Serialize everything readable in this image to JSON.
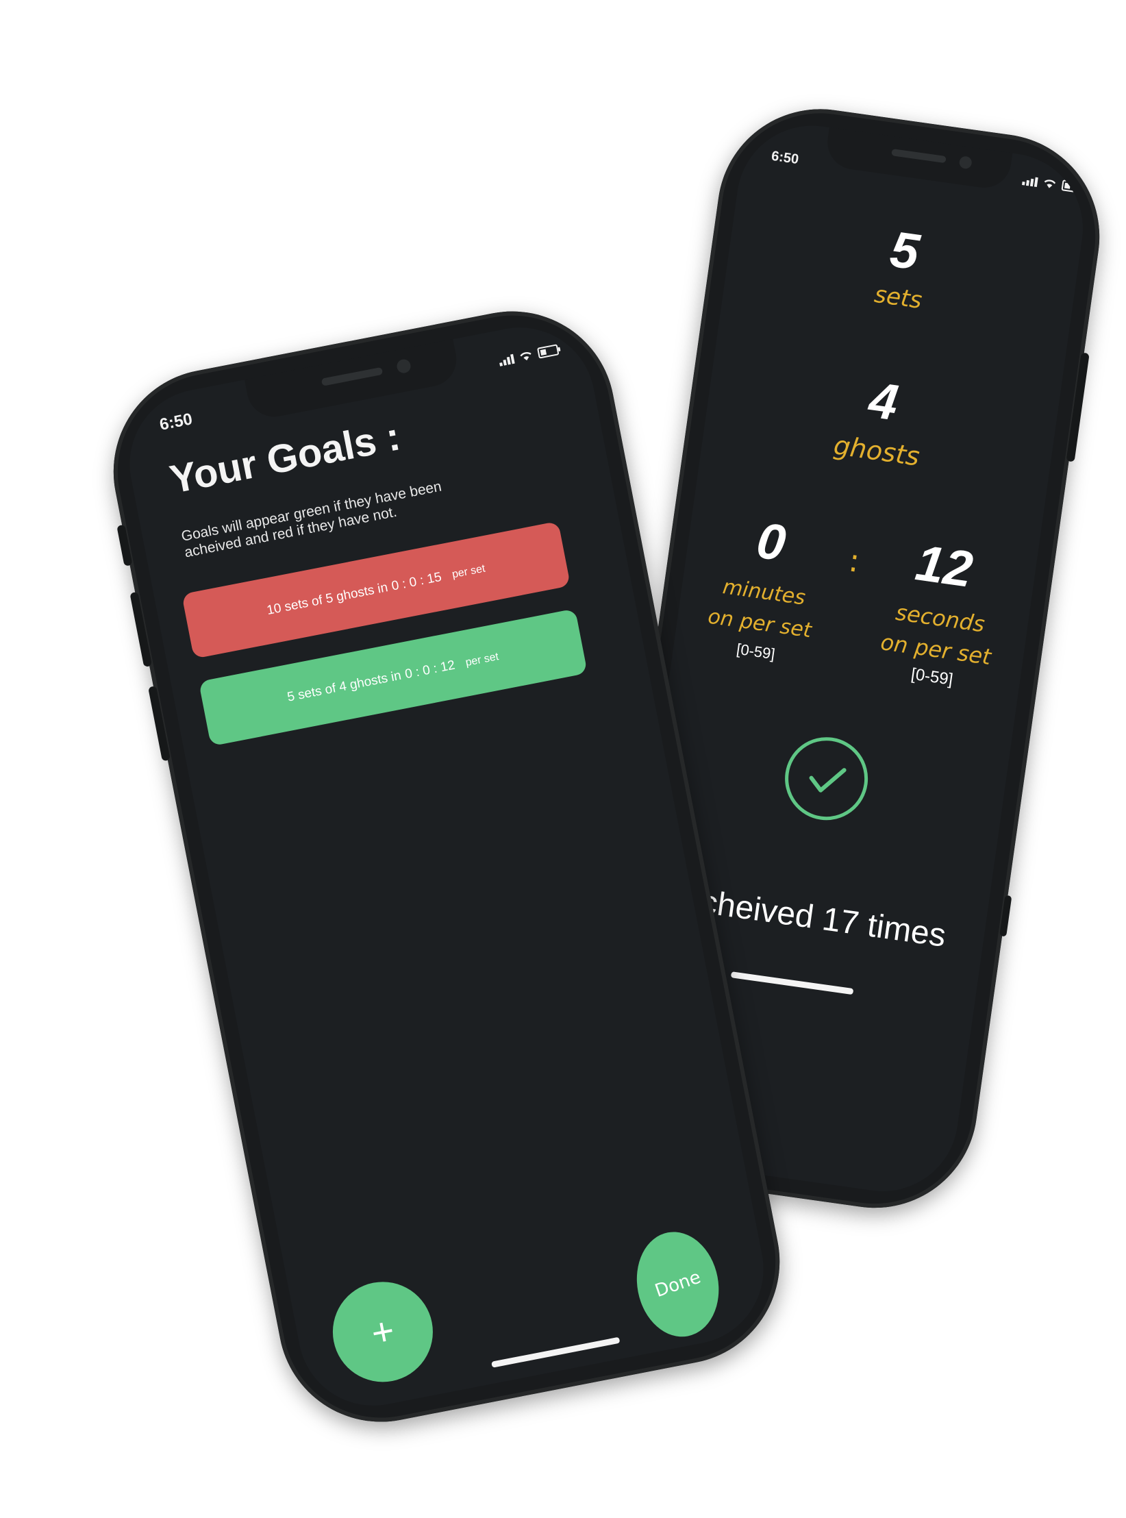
{
  "left_phone": {
    "status": {
      "time": "6:50"
    },
    "title": "Your Goals :",
    "description": "Goals will appear green if they have been acheived and red if they have not.",
    "goals": [
      {
        "prefix": "10 sets of 5 ghosts in",
        "time": "0 : 0 : 15",
        "suffix": "per set",
        "achieved": false,
        "color": "#d55a57"
      },
      {
        "prefix": "5 sets of 4 ghosts in",
        "time": "0 : 0 : 12",
        "suffix": "per set",
        "achieved": true,
        "color": "#5fc785"
      }
    ],
    "add_button": {
      "label": "+",
      "icon": "plus-icon"
    },
    "done_button": {
      "label": "Done"
    }
  },
  "right_phone": {
    "status": {
      "time": "6:50"
    },
    "sets": {
      "value": "5",
      "label": "sets"
    },
    "ghosts": {
      "value": "4",
      "label": "ghosts"
    },
    "minutes": {
      "value": "0",
      "label_line1": "minutes",
      "label_line2": "on per set",
      "range": "[0-59]"
    },
    "separator": ":",
    "seconds": {
      "value": "12",
      "label_line1": "seconds",
      "label_line2": "on per set",
      "range": "[0-59]"
    },
    "check_icon": "check-circle-icon",
    "check_color": "#5fc785",
    "achieved_text": "Acheived 17 times"
  },
  "colors": {
    "background": "#ffffff",
    "phone_body": "#191b1d",
    "screen": "#1c1f22",
    "accent_green": "#5fc785",
    "accent_red": "#d55a57",
    "label_gold": "#e3b02e"
  }
}
